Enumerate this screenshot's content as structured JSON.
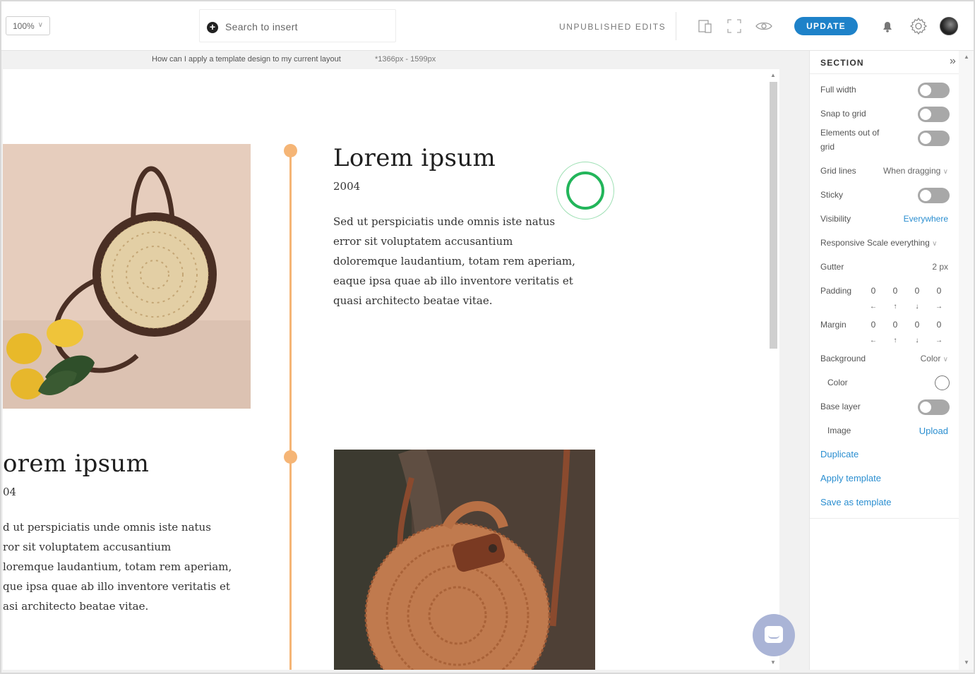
{
  "toolbar": {
    "zoom": "100%",
    "search_placeholder": "Search to insert",
    "status": "UNPUBLISHED EDITS",
    "update_label": "UPDATE",
    "accent": "#1e82c9"
  },
  "info": {
    "question": "How can I apply a template design to my current layout",
    "dims": "*1366px - 1599px"
  },
  "canvas": {
    "block1": {
      "title": "Lorem ipsum",
      "year": "2004",
      "lines": [
        "Sed ut perspiciatis unde omnis iste natus",
        "error sit voluptatem accusantium",
        "doloremque laudantium, totam rem aperiam,",
        "eaque ipsa quae ab illo inventore veritatis et",
        "quasi architecto beatae vitae."
      ]
    },
    "block2": {
      "title": "orem ipsum",
      "year": "04",
      "lines": [
        "d ut perspiciatis unde omnis iste natus",
        "ror sit voluptatem accusantium",
        "loremque laudantium, totam rem aperiam,",
        "que ipsa quae ab illo inventore veritatis et",
        "asi architecto beatae vitae."
      ]
    },
    "timeline_color": "#f5b576",
    "highlight_color": "#22b55a"
  },
  "panel": {
    "title": "SECTION",
    "full_width": "Full width",
    "snap_to_grid": "Snap to grid",
    "elements_out_of_grid_1": "Elements out of",
    "elements_out_of_grid_2": "grid",
    "grid_lines": "Grid lines",
    "grid_lines_value": "When dragging",
    "sticky": "Sticky",
    "visibility": "Visibility",
    "visibility_value": "Everywhere",
    "responsive_scale": "Responsive Scale everything",
    "gutter": "Gutter",
    "gutter_value": "2 px",
    "padding": "Padding",
    "padding_values": [
      "0",
      "0",
      "0",
      "0"
    ],
    "margin": "Margin",
    "margin_values": [
      "0",
      "0",
      "0",
      "0"
    ],
    "background": "Background",
    "background_value": "Color",
    "color": "Color",
    "base_layer": "Base layer",
    "image": "Image",
    "upload": "Upload",
    "duplicate": "Duplicate",
    "apply_template": "Apply template",
    "save_as_template": "Save as template",
    "link_color": "#2a8ed0"
  }
}
